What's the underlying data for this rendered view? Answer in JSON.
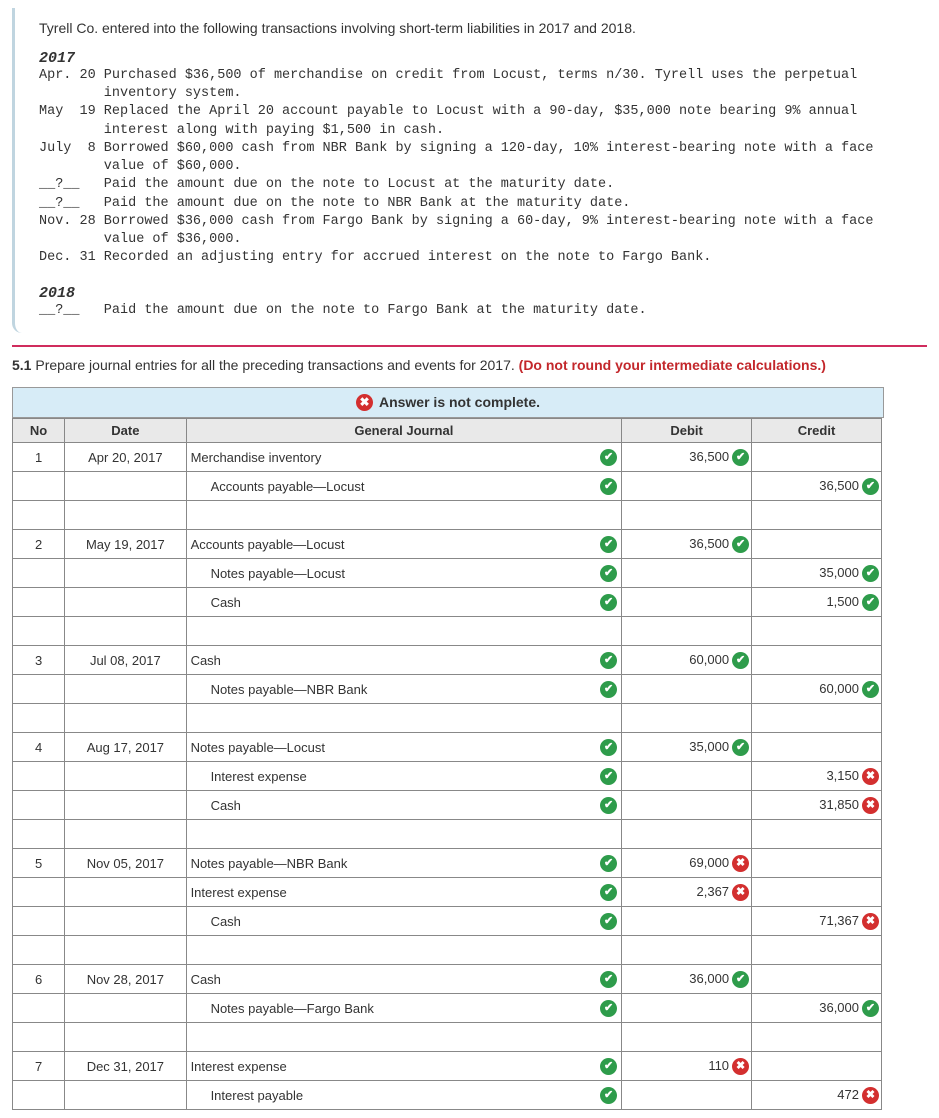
{
  "problem": {
    "intro": "Tyrell Co. entered into the following transactions involving short-term liabilities in 2017 and 2018.",
    "y2017": "2017",
    "lines2017": "Apr. 20 Purchased $36,500 of merchandise on credit from Locust, terms n/30. Tyrell uses the perpetual\n        inventory system.\nMay  19 Replaced the April 20 account payable to Locust with a 90-day, $35,000 note bearing 9% annual\n        interest along with paying $1,500 in cash.\nJuly  8 Borrowed $60,000 cash from NBR Bank by signing a 120-day, 10% interest-bearing note with a face\n        value of $60,000.\n__?__   Paid the amount due on the note to Locust at the maturity date.\n__?__   Paid the amount due on the note to NBR Bank at the maturity date.\nNov. 28 Borrowed $36,000 cash from Fargo Bank by signing a 60-day, 9% interest-bearing note with a face\n        value of $36,000.\nDec. 31 Recorded an adjusting entry for accrued interest on the note to Fargo Bank.",
    "y2018": "2018",
    "lines2018": "__?__   Paid the amount due on the note to Fargo Bank at the maturity date."
  },
  "question": {
    "num": "5.1",
    "text": " Prepare journal entries for all the preceding transactions and events for 2017. ",
    "red": "(Do not round your intermediate calculations.)"
  },
  "banner": "Answer is not complete.",
  "headers": {
    "no": "No",
    "date": "Date",
    "gj": "General Journal",
    "debit": "Debit",
    "credit": "Credit"
  },
  "rows": [
    {
      "no": "1",
      "date": "Apr 20, 2017",
      "gj": "Merchandise inventory",
      "gmark": "ok",
      "debit": "36,500",
      "dmark": "ok"
    },
    {
      "gj": "Accounts payable—Locust",
      "indent": true,
      "gmark": "ok",
      "credit": "36,500",
      "cmark": "ok"
    },
    {
      "blank": true
    },
    {
      "no": "2",
      "date": "May 19, 2017",
      "gj": "Accounts payable—Locust",
      "gmark": "ok",
      "debit": "36,500",
      "dmark": "ok"
    },
    {
      "gj": "Notes payable—Locust",
      "indent": true,
      "gmark": "ok",
      "credit": "35,000",
      "cmark": "ok"
    },
    {
      "gj": "Cash",
      "indent": true,
      "gmark": "ok",
      "credit": "1,500",
      "cmark": "ok"
    },
    {
      "blank": true
    },
    {
      "no": "3",
      "date": "Jul 08, 2017",
      "gj": "Cash",
      "gmark": "ok",
      "debit": "60,000",
      "dmark": "ok"
    },
    {
      "gj": "Notes payable—NBR Bank",
      "indent": true,
      "gmark": "ok",
      "credit": "60,000",
      "cmark": "ok"
    },
    {
      "blank": true
    },
    {
      "no": "4",
      "date": "Aug 17, 2017",
      "gj": "Notes payable—Locust",
      "gmark": "ok",
      "debit": "35,000",
      "dmark": "ok"
    },
    {
      "gj": "Interest expense",
      "indent": true,
      "gmark": "ok",
      "credit": "3,150",
      "cmark": "bad"
    },
    {
      "gj": "Cash",
      "indent": true,
      "gmark": "ok",
      "credit": "31,850",
      "cmark": "bad"
    },
    {
      "blank": true
    },
    {
      "no": "5",
      "date": "Nov 05, 2017",
      "gj": "Notes payable—NBR Bank",
      "gmark": "ok",
      "debit": "69,000",
      "dmark": "bad"
    },
    {
      "gj": "Interest expense",
      "gmark": "ok",
      "debit": "2,367",
      "dmark": "bad"
    },
    {
      "gj": "Cash",
      "indent": true,
      "gmark": "ok",
      "credit": "71,367",
      "cmark": "bad"
    },
    {
      "blank": true
    },
    {
      "no": "6",
      "date": "Nov 28, 2017",
      "gj": "Cash",
      "gmark": "ok",
      "debit": "36,000",
      "dmark": "ok"
    },
    {
      "gj": "Notes payable—Fargo Bank",
      "indent": true,
      "gmark": "ok",
      "credit": "36,000",
      "cmark": "ok"
    },
    {
      "blank": true
    },
    {
      "no": "7",
      "date": "Dec 31, 2017",
      "gj": "Interest expense",
      "gmark": "ok",
      "debit": "110",
      "dmark": "bad"
    },
    {
      "gj": "Interest payable",
      "indent": true,
      "gmark": "ok",
      "credit": "472",
      "cmark": "bad"
    }
  ]
}
